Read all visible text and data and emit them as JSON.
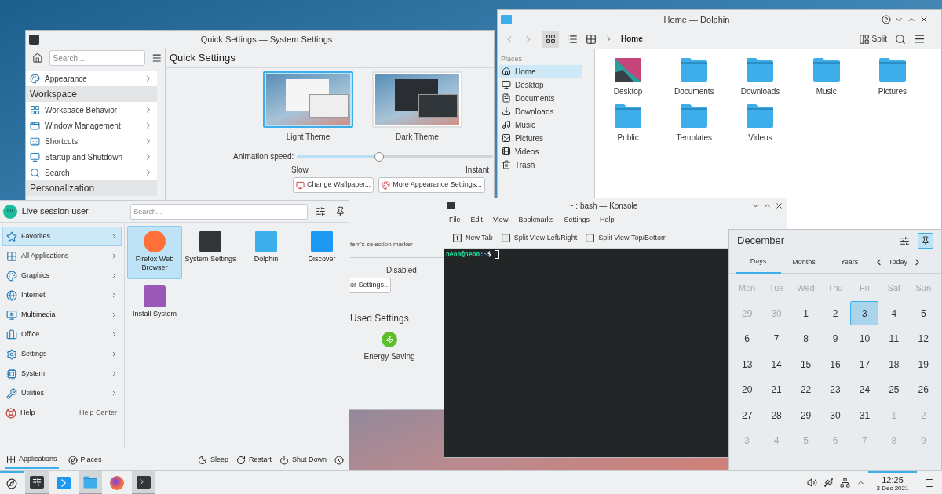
{
  "settings_window": {
    "title": "Quick Settings — System Settings",
    "search": {
      "placeholder": "Search..."
    },
    "sidebar": [
      {
        "kind": "item",
        "label": "Appearance"
      },
      {
        "kind": "header",
        "label": "Workspace"
      },
      {
        "kind": "item",
        "label": "Workspace Behavior"
      },
      {
        "kind": "item",
        "label": "Window Management"
      },
      {
        "kind": "item",
        "label": "Shortcuts"
      },
      {
        "kind": "item",
        "label": "Startup and Shutdown"
      },
      {
        "kind": "item",
        "label": "Search"
      },
      {
        "kind": "header",
        "label": "Personalization"
      }
    ],
    "heading": "Quick Settings",
    "themes": [
      {
        "label": "Light Theme",
        "selected": true
      },
      {
        "label": "Dark Theme",
        "selected": false
      }
    ],
    "animation": {
      "label": "Animation speed:",
      "level": 0.42,
      "min_label": "Slow",
      "max_label": "Instant"
    },
    "buttons": [
      "Change Wallpaper...",
      "More Appearance Settings..."
    ],
    "marker_text": "tem's selection marker",
    "disabled_label": "Disabled",
    "behavior_button": "or Settings...",
    "most_used": {
      "heading": "Used Settings",
      "items": [
        "Energy Saving"
      ]
    }
  },
  "dolphin": {
    "title": "Home — Dolphin",
    "breadcrumb": "Home",
    "split": "Split",
    "places_header": "Places",
    "places": [
      {
        "label": "Home",
        "selected": true
      },
      {
        "label": "Desktop",
        "selected": false
      },
      {
        "label": "Documents",
        "selected": false
      },
      {
        "label": "Downloads",
        "selected": false
      },
      {
        "label": "Music",
        "selected": false
      },
      {
        "label": "Pictures",
        "selected": false
      },
      {
        "label": "Videos",
        "selected": false
      },
      {
        "label": "Trash",
        "selected": false
      }
    ],
    "files": [
      {
        "label": "Desktop",
        "kind": "desktop"
      },
      {
        "label": "Documents",
        "kind": "folder"
      },
      {
        "label": "Downloads",
        "kind": "folder"
      },
      {
        "label": "Music",
        "kind": "folder"
      },
      {
        "label": "Pictures",
        "kind": "folder"
      },
      {
        "label": "Public",
        "kind": "folder"
      },
      {
        "label": "Templates",
        "kind": "folder"
      },
      {
        "label": "Videos",
        "kind": "folder"
      }
    ]
  },
  "konsole": {
    "title": "~ : bash — Konsole",
    "menu": [
      "File",
      "Edit",
      "View",
      "Bookmarks",
      "Settings",
      "Help"
    ],
    "toolbar": [
      "New Tab",
      "Split View Left/Right",
      "Split View Top/Bottom"
    ],
    "prompt_user": "neon@neon",
    "prompt_path": ":~",
    "prompt_symbol": "$"
  },
  "calendar": {
    "month": "December",
    "tabs": [
      {
        "label": "Days",
        "selected": true
      },
      {
        "label": "Months",
        "selected": false
      },
      {
        "label": "Years",
        "selected": false
      }
    ],
    "today": "Today",
    "pinned": true,
    "weekdays": [
      "Mon",
      "Tue",
      "Wed",
      "Thu",
      "Fri",
      "Sat",
      "Sun"
    ],
    "weeks": [
      [
        {
          "day": "29",
          "dim": true,
          "selected": false
        },
        {
          "day": "30",
          "dim": true,
          "selected": false
        },
        {
          "day": "1",
          "dim": false,
          "selected": false
        },
        {
          "day": "2",
          "dim": false,
          "selected": false
        },
        {
          "day": "3",
          "dim": false,
          "selected": true
        },
        {
          "day": "4",
          "dim": false,
          "selected": false
        },
        {
          "day": "5",
          "dim": false,
          "selected": false
        }
      ],
      [
        {
          "day": "6",
          "dim": false,
          "selected": false
        },
        {
          "day": "7",
          "dim": false,
          "selected": false
        },
        {
          "day": "8",
          "dim": false,
          "selected": false
        },
        {
          "day": "9",
          "dim": false,
          "selected": false
        },
        {
          "day": "10",
          "dim": false,
          "selected": false
        },
        {
          "day": "11",
          "dim": false,
          "selected": false
        },
        {
          "day": "12",
          "dim": false,
          "selected": false
        }
      ],
      [
        {
          "day": "13",
          "dim": false,
          "selected": false
        },
        {
          "day": "14",
          "dim": false,
          "selected": false
        },
        {
          "day": "15",
          "dim": false,
          "selected": false
        },
        {
          "day": "16",
          "dim": false,
          "selected": false
        },
        {
          "day": "17",
          "dim": false,
          "selected": false
        },
        {
          "day": "18",
          "dim": false,
          "selected": false
        },
        {
          "day": "19",
          "dim": false,
          "selected": false
        }
      ],
      [
        {
          "day": "20",
          "dim": false,
          "selected": false
        },
        {
          "day": "21",
          "dim": false,
          "selected": false
        },
        {
          "day": "22",
          "dim": false,
          "selected": false
        },
        {
          "day": "23",
          "dim": false,
          "selected": false
        },
        {
          "day": "24",
          "dim": false,
          "selected": false
        },
        {
          "day": "25",
          "dim": false,
          "selected": false
        },
        {
          "day": "26",
          "dim": false,
          "selected": false
        }
      ],
      [
        {
          "day": "27",
          "dim": false,
          "selected": false
        },
        {
          "day": "28",
          "dim": false,
          "selected": false
        },
        {
          "day": "29",
          "dim": false,
          "selected": false
        },
        {
          "day": "30",
          "dim": false,
          "selected": false
        },
        {
          "day": "31",
          "dim": false,
          "selected": false
        },
        {
          "day": "1",
          "dim": true,
          "selected": false
        },
        {
          "day": "2",
          "dim": true,
          "selected": false
        }
      ],
      [
        {
          "day": "3",
          "dim": true,
          "selected": false
        },
        {
          "day": "4",
          "dim": true,
          "selected": false
        },
        {
          "day": "5",
          "dim": true,
          "selected": false
        },
        {
          "day": "6",
          "dim": true,
          "selected": false
        },
        {
          "day": "7",
          "dim": true,
          "selected": false
        },
        {
          "day": "8",
          "dim": true,
          "selected": false
        },
        {
          "day": "9",
          "dim": true,
          "selected": false
        }
      ]
    ]
  },
  "launcher": {
    "avatar": "Lu",
    "user": "Live session user",
    "search": {
      "placeholder": "Search..."
    },
    "categories": [
      {
        "label": "Favorites",
        "selected": true
      },
      {
        "label": "All Applications",
        "selected": false
      },
      {
        "label": "Graphics",
        "selected": false
      },
      {
        "label": "Internet",
        "selected": false
      },
      {
        "label": "Multimedia",
        "selected": false
      },
      {
        "label": "Office",
        "selected": false
      },
      {
        "label": "Settings",
        "selected": false
      },
      {
        "label": "System",
        "selected": false
      },
      {
        "label": "Utilities",
        "selected": false
      }
    ],
    "help": {
      "label": "Help",
      "detail": "Help Center"
    },
    "apps": [
      {
        "label": "Firefox Web Browser",
        "selected": true
      },
      {
        "label": "System Settings",
        "selected": false
      },
      {
        "label": "Dolphin",
        "selected": false
      },
      {
        "label": "Discover",
        "selected": false
      },
      {
        "label": "Install System",
        "selected": false
      }
    ],
    "footer_tabs": [
      {
        "label": "Applications",
        "selected": true
      },
      {
        "label": "Places",
        "selected": false
      }
    ],
    "actions": [
      "Sleep",
      "Restart",
      "Shut Down"
    ]
  },
  "taskbar": {
    "tasks": [
      {
        "kind": "settings",
        "active": true
      },
      {
        "kind": "discover",
        "active": false
      },
      {
        "kind": "dolphin",
        "active": true
      },
      {
        "kind": "firefox",
        "active": false
      },
      {
        "kind": "konsole",
        "active": true
      }
    ],
    "time": "12:25",
    "date": "3 Dec 2021"
  }
}
